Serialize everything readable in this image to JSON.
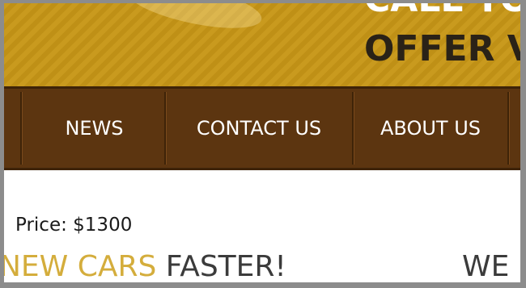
{
  "banner": {
    "line1": "CALL TOI",
    "line2": "OFFER VA"
  },
  "nav": {
    "items": [
      {
        "label": "NEWS"
      },
      {
        "label": "CONTACT US"
      },
      {
        "label": "ABOUT US"
      }
    ]
  },
  "content": {
    "price": "Price: $1300",
    "headline_accent": "NEW CARS",
    "headline_dark": "FASTER!",
    "headline_right": "WE"
  },
  "colors": {
    "banner_gold": "#c99a1e",
    "nav_brown": "#5c3510",
    "accent_gold": "#d4ad3c",
    "dark_text": "#3b3b3b"
  }
}
